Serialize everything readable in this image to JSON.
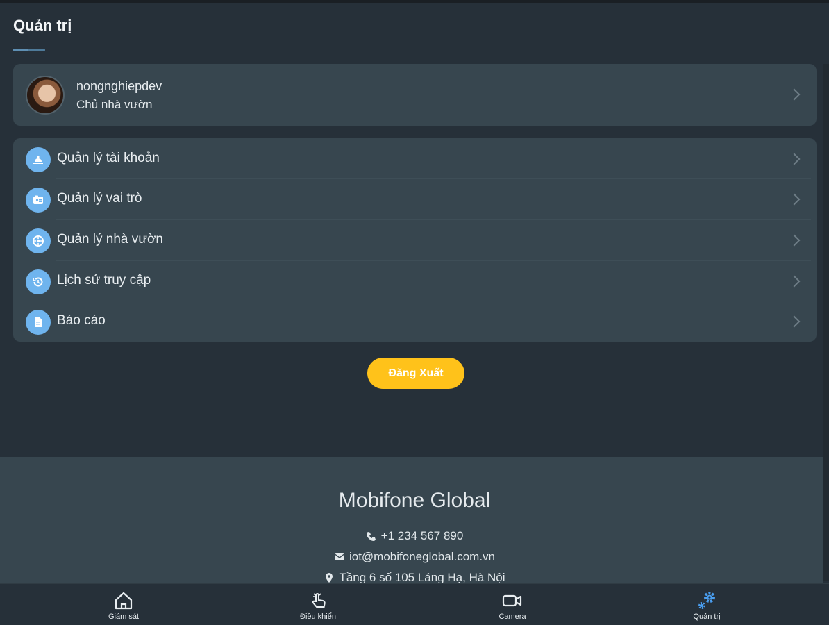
{
  "header": {
    "title": "Quản trị"
  },
  "profile": {
    "username": "nongnghiepdev",
    "role": "Chủ nhà vườn"
  },
  "menu": {
    "items": [
      {
        "label": "Quản lý tài khoản",
        "icon": "account-icon"
      },
      {
        "label": "Quản lý vai trò",
        "icon": "role-icon"
      },
      {
        "label": "Quản lý nhà vườn",
        "icon": "garden-icon"
      },
      {
        "label": "Lịch sử truy cập",
        "icon": "history-icon"
      },
      {
        "label": "Báo cáo",
        "icon": "report-icon"
      }
    ]
  },
  "actions": {
    "logout_label": "Đăng Xuất"
  },
  "footer": {
    "brand": "Mobifone Global",
    "phone": "+1 234 567 890",
    "email": "iot@mobifoneglobal.com.vn",
    "address": "Tầng 6 số 105 Láng Hạ, Hà Nội"
  },
  "bottom_nav": {
    "items": [
      {
        "label": "Giám sát",
        "icon": "home-icon"
      },
      {
        "label": "Điều khiển",
        "icon": "hand-touch-icon"
      },
      {
        "label": "Camera",
        "icon": "camera-icon"
      },
      {
        "label": "Quản trị",
        "icon": "settings-gears-icon"
      }
    ],
    "active_index": 3
  },
  "colors": {
    "background": "#263039",
    "card": "#37464f",
    "accent_blue": "#6fb4ee",
    "logout_button": "#ffc21a"
  }
}
